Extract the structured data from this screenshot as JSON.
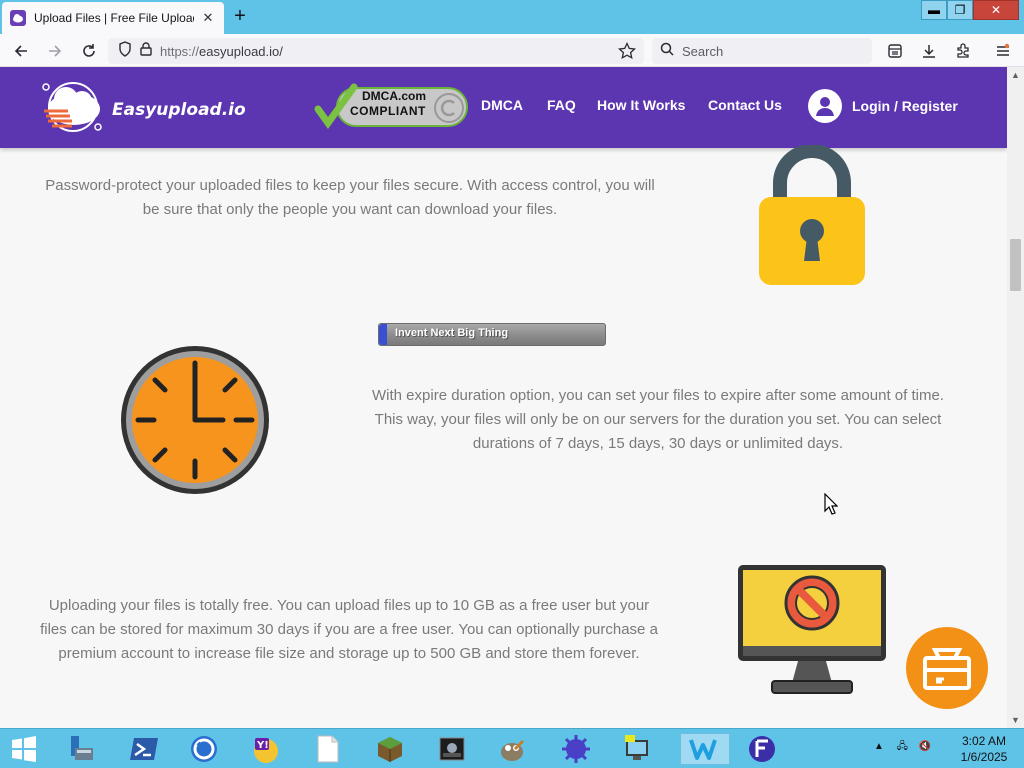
{
  "browser": {
    "tab_title": "Upload Files | Free File Upload a",
    "tab_close": "✕",
    "new_tab": "+",
    "url_scheme": "https://",
    "url_host": "easyupload.io/",
    "search_placeholder": "Search",
    "window_minimize": "▬",
    "window_restore": "❐",
    "window_close": "✕"
  },
  "site": {
    "logo_text": "Easyupload.io",
    "dmca_line1": "DMCA.com",
    "dmca_line2": "COMPLIANT",
    "nav": [
      "DMCA",
      "FAQ",
      "How It Works",
      "Contact Us"
    ],
    "login_label": "Login / Register"
  },
  "content": {
    "password_text": "Password-protect your uploaded files to keep your files secure. With access control, you will be sure that only the people you want can download your files.",
    "invent_banner": "Invent Next Big Thing",
    "expire_text": "With expire duration option, you can set your files to expire after some amount of time. This way, your files will only be on our servers for the duration you set. You can select durations of 7 days, 15 days, 30 days or unlimited days.",
    "free_text": "Uploading your files is totally free. You can upload files up to 10 GB as a free user but your files can be stored for maximum 30 days if you are a free user. You can optionally purchase a premium account to increase file size and storage up to 500 GB and store them forever."
  },
  "taskbar": {
    "time": "3:02 AM",
    "date": "1/6/2025"
  },
  "colors": {
    "header_purple": "#5c35b0",
    "lock_yellow": "#fcc419",
    "clock_orange": "#f7941d",
    "gift_orange": "#f39116",
    "taskbar_blue": "#5fc3e8"
  }
}
